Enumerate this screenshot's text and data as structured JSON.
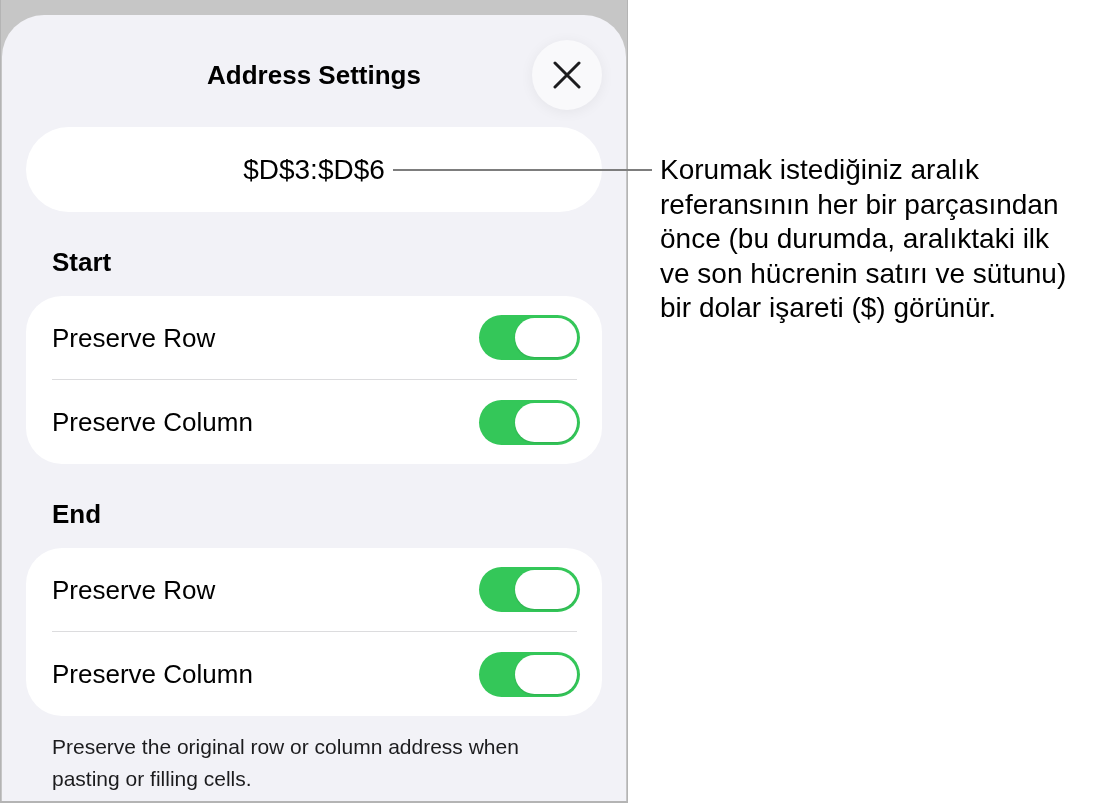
{
  "sheet": {
    "title": "Address Settings",
    "address_field": {
      "value": "$D$3:$D$6"
    },
    "sections": [
      {
        "heading": "Start",
        "options": [
          {
            "label": "Preserve Row",
            "on": true
          },
          {
            "label": "Preserve Column",
            "on": true
          }
        ]
      },
      {
        "heading": "End",
        "options": [
          {
            "label": "Preserve Row",
            "on": true
          },
          {
            "label": "Preserve Column",
            "on": true
          }
        ]
      }
    ],
    "footer_note": "Preserve the original row or column address when pasting or filling cells."
  },
  "callout": {
    "text": "Korumak istediğiniz aralık referansının her bir parçasından önce (bu durumda, aralıktaki ilk ve son hücrenin satırı ve sütunu) bir dolar işareti ($) görünür."
  }
}
